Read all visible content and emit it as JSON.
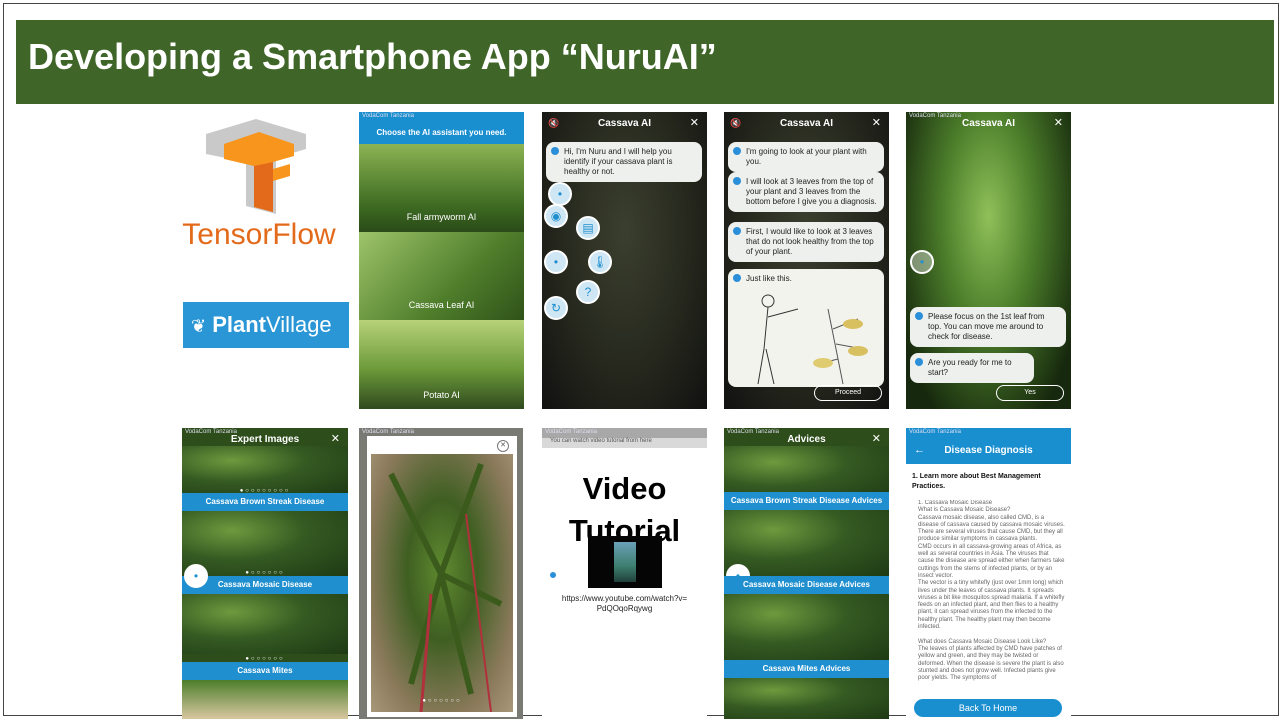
{
  "slide": {
    "title": "Developing a Smartphone App “NuruAI”"
  },
  "logos": {
    "tensorflow": "TensorFlow",
    "plantvillage_prefix": "Plant",
    "plantvillage_suffix": "Village"
  },
  "status_bar": "VodaCom Tanzania",
  "screens": {
    "choose": {
      "header": "Choose the AI assistant you need.",
      "options": [
        "Fall armyworm AI",
        "Cassava Leaf AI",
        "Potato AI"
      ]
    },
    "intro": {
      "title": "Cassava AI",
      "message": "Hi, I'm Nuru and I will help you identify if your cassava plant is healthy or not."
    },
    "instructions": {
      "title": "Cassava AI",
      "messages": [
        "I'm going to look at your plant with you.",
        "I will look at 3 leaves from the top of your plant and 3 leaves from the bottom before I give you a diagnosis.",
        "First, I would like to look at 3 leaves that do not look healthy from the top of your plant.",
        "Just like this."
      ],
      "button": "Proceed"
    },
    "camera": {
      "title": "Cassava AI",
      "messages": [
        "Please focus on the 1st leaf from top. You can move me around to check for disease.",
        "Are you ready for me to start?"
      ],
      "button": "Yes"
    },
    "expert": {
      "title": "Expert Images",
      "labels": [
        "Cassava Brown Streak Disease",
        "Cassava Mosaic Disease",
        "Cassava Mites"
      ]
    },
    "video": {
      "hint": "You can watch video tutorial from here",
      "label_line1": "Video",
      "label_line2": "Tutorial",
      "url_line1": "https://www.youtube.com/watch?v=",
      "url_line2": "PdQOqoRqywg"
    },
    "advices": {
      "title": "Advices",
      "labels": [
        "Cassava Brown Streak Disease Advices",
        "Cassava Mosaic Disease Advices",
        "Cassava Mites Advices"
      ]
    },
    "diagnosis": {
      "title": "Disease Diagnosis",
      "section_title": "1. Learn more about Best Management Practices.",
      "body": "1. Cassava Mosaic Disease\nWhat is Cassava Mosaic Disease?\nCassava mosaic disease, also called CMD, is a disease of cassava caused by cassava mosaic viruses. There are several viruses that cause CMD, but they all produce similar symptoms in cassava plants.\nCMD occurs in all cassava-growing areas of Africa, as well as several countries in Asia. The viruses that cause the disease are spread either when farmers take cuttings from the stems of infected plants, or by an insect vector.\nThe vector is a tiny whitefly (just over 1mm long) which lives under the leaves of cassava plants. It spreads viruses a bit like mosquitos spread malaria. If a whitefly feeds on an infected plant, and then flies to a healthy plant, it can spread viruses from the infected to the healthy plant. The healthy plant may then become infected.\n\nWhat does Cassava Mosaic Disease Look Like?\nThe leaves of plants affected by CMD have patches of yellow and green, and they may be twisted or deformed. When the disease is severe the plant is also stunted and does not grow well. Infected plants give poor yields. The symptoms of",
      "button": "Back To Home"
    }
  }
}
